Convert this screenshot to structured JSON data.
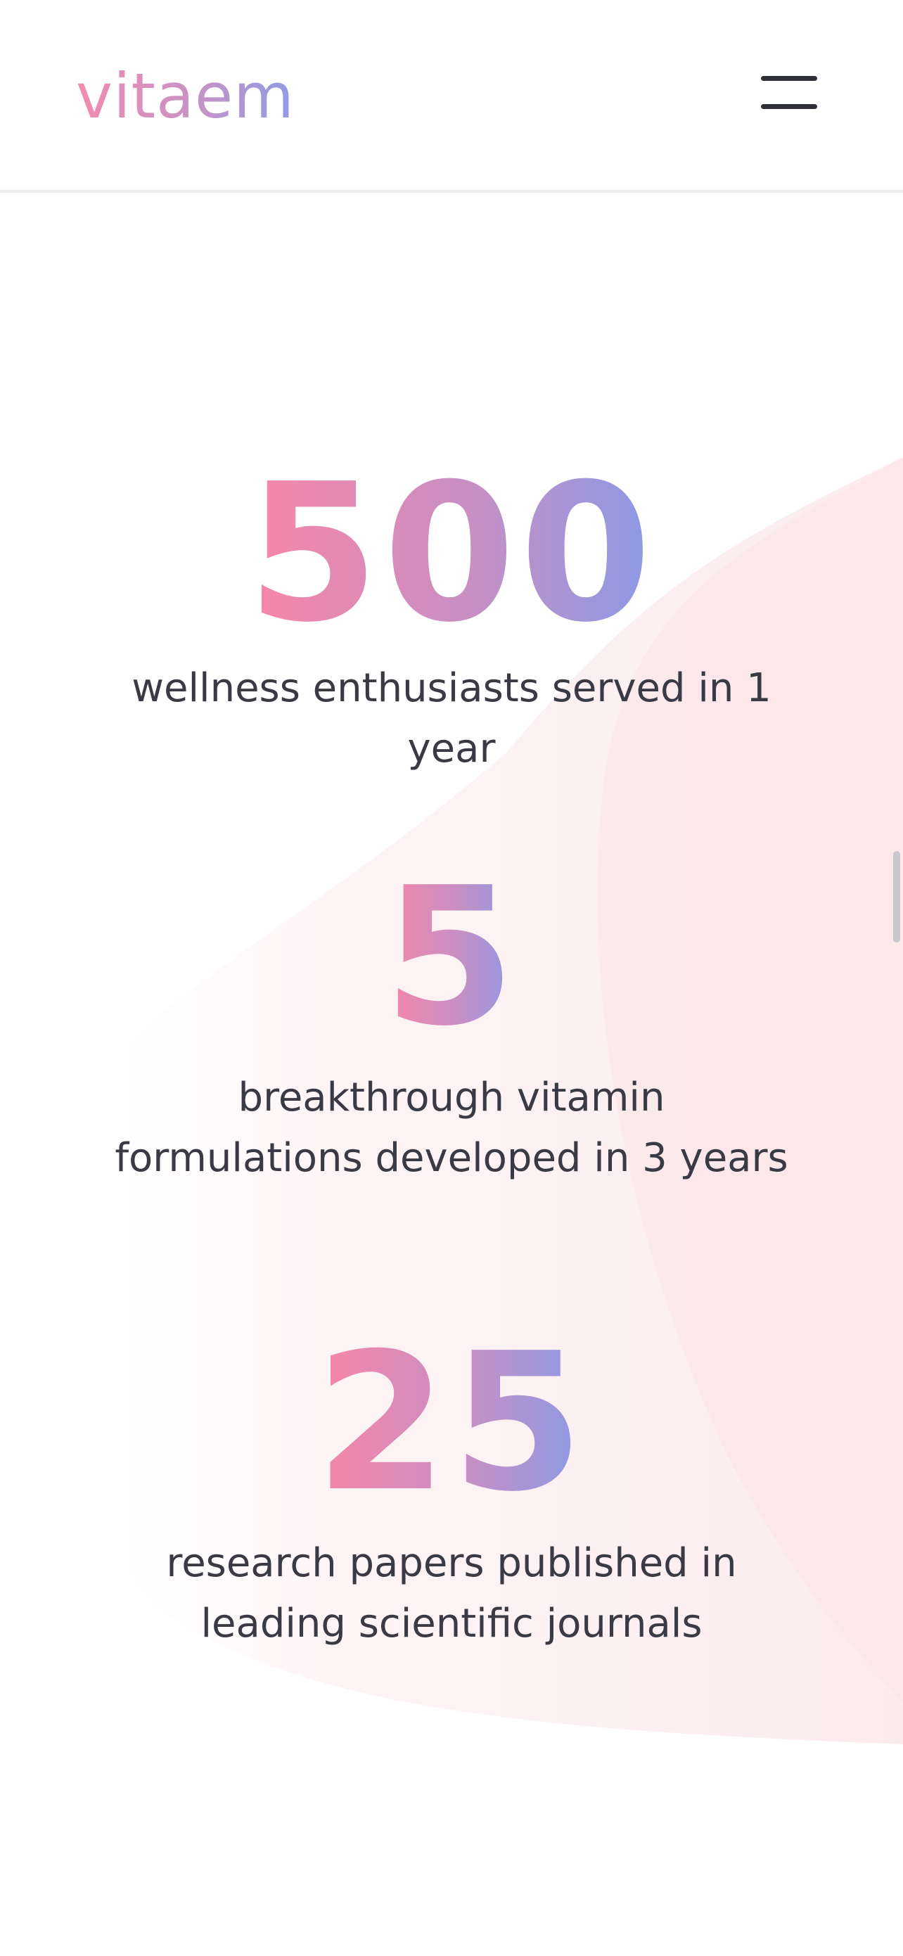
{
  "header": {
    "logo_text": "vitaem",
    "menu_icon": "hamburger-menu-icon"
  },
  "stats": [
    {
      "number": "500",
      "label": "wellness enthusiasts served in 1 year"
    },
    {
      "number": "5",
      "label": "breakthrough vitamin formulations developed in 3 years"
    },
    {
      "number": "25",
      "label": "research papers published in leading scientific journals"
    }
  ],
  "colors": {
    "gradient_start": "#f886a7",
    "gradient_mid": "#c78fc4",
    "gradient_end": "#8a9ae6",
    "text": "#3a3a44",
    "blob": "#fdeef0"
  }
}
